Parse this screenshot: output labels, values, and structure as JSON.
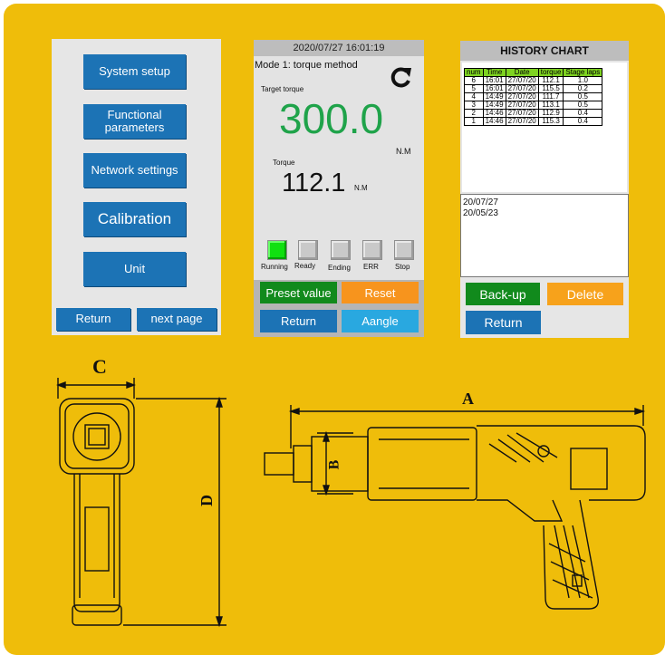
{
  "panel_setup": {
    "buttons": [
      "System setup",
      "Functional\nparameters",
      "Network settings",
      "Calibration",
      "Unit"
    ],
    "return_label": "Return",
    "next_label": "next page"
  },
  "panel_run": {
    "datetime": "2020/07/27 16:01:19",
    "mode": "Mode 1: torque method",
    "target_label": "Target torque",
    "target_value": "300.0",
    "target_unit": "N.M",
    "torque_label": "Torque",
    "torque_value": "112.1",
    "torque_unit": "N.M",
    "indicators": [
      {
        "label": "Running",
        "on": true
      },
      {
        "label": "Ready",
        "on": false
      },
      {
        "label": "Ending",
        "on": false
      },
      {
        "label": "ERR",
        "on": false
      },
      {
        "label": "Stop",
        "on": false
      }
    ],
    "buttons": {
      "preset": "Preset value",
      "reset": "Reset",
      "return": "Return",
      "angle": "Aangle"
    },
    "colors": {
      "target_value": "#1fa34a",
      "preset": "#118a1c",
      "reset": "#f7941d",
      "return": "#1c73b5",
      "angle": "#29a8e0"
    }
  },
  "panel_history": {
    "title": "HISTORY CHART",
    "columns": [
      "num",
      "Time",
      "Date",
      "torque",
      "Stage laps"
    ],
    "rows": [
      [
        "6",
        "16:01",
        "27/07/20",
        "112.1",
        "1.0"
      ],
      [
        "5",
        "16:01",
        "27/07/20",
        "115.5",
        "0.2"
      ],
      [
        "4",
        "14:49",
        "27/07/20",
        "111.7",
        "0.5"
      ],
      [
        "3",
        "14:49",
        "27/07/20",
        "113.1",
        "0.5"
      ],
      [
        "2",
        "14:46",
        "27/07/20",
        "112.9",
        "0.4"
      ],
      [
        "1",
        "14:46",
        "27/07/20",
        "115.3",
        "0.4"
      ]
    ],
    "list": [
      "20/07/27",
      "20/05/23"
    ],
    "backup_label": "Back-up",
    "delete_label": "Delete",
    "return_label": "Return"
  },
  "drawings": {
    "front_dims": {
      "width": "C",
      "height": "D"
    },
    "side_dims": {
      "length": "A",
      "diameter": "B"
    }
  }
}
